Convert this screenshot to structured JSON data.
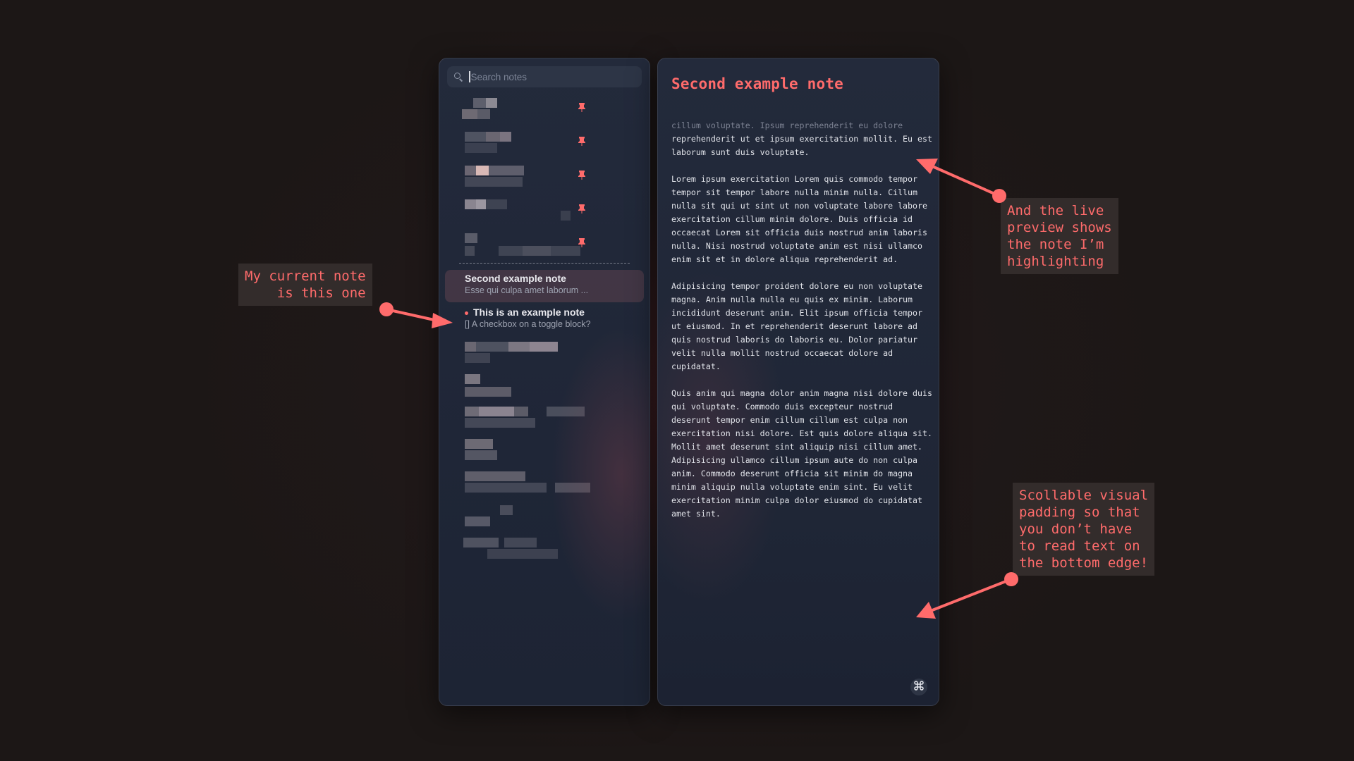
{
  "search": {
    "placeholder": "Search notes"
  },
  "notes": [
    {
      "title": "Second example note",
      "preview": "Esse qui culpa amet laborum ..."
    },
    {
      "title": "This is an example note",
      "preview": "[] A checkbox on a toggle block?"
    }
  ],
  "preview": {
    "title": "Second example note",
    "paragraphs": [
      {
        "faded": "cillum voluptate. Ipsum reprehenderit eu dolore",
        "text": "reprehenderit ut et ipsum exercitation mollit. Eu est laborum sunt duis voluptate."
      },
      {
        "text": "Lorem ipsum exercitation Lorem quis commodo tempor tempor sit tempor labore nulla minim nulla. Cillum nulla sit qui ut sint ut non voluptate labore labore exercitation cillum minim dolore. Duis officia id occaecat Lorem sit officia duis nostrud anim laboris nulla. Nisi nostrud voluptate anim est nisi ullamco enim sit et in dolore aliqua reprehenderit ad."
      },
      {
        "text": "Adipisicing tempor proident dolore eu non voluptate magna. Anim nulla nulla eu quis ex minim. Laborum incididunt deserunt anim. Elit ipsum officia tempor ut eiusmod. In et reprehenderit deserunt labore ad quis nostrud laboris do laboris eu. Dolor pariatur velit nulla mollit nostrud occaecat dolore ad cupidatat."
      },
      {
        "text": "Quis anim qui magna dolor anim magna nisi dolore duis qui voluptate. Commodo duis excepteur nostrud deserunt tempor enim cillum cillum est culpa non exercitation nisi dolore. Est quis dolore aliqua sit. Mollit amet deserunt sint aliquip nisi cillum amet. Adipisicing ullamco cillum ipsum aute do non culpa anim. Commodo deserunt officia sit minim do magna minim aliquip nulla voluptate enim sint. Eu velit exercitation minim culpa dolor eiusmod do cupidatat amet sint."
      }
    ]
  },
  "annotations": {
    "current_note": "My current note\n   is this one",
    "live_preview": "And the live\npreview shows\nthe note I’m\nhighlighting",
    "padding": "Scollable visual\npadding so that\nyou don’t have\nto read text on\nthe bottom edge!"
  },
  "colors": {
    "accent": "#ff6b6b",
    "panel": "#222a3b",
    "background": "#1c1716",
    "annotation_bg": "#332c2b"
  },
  "icons": {
    "search": "search-icon",
    "pin": "pin-icon",
    "expand": "expand-icon"
  }
}
